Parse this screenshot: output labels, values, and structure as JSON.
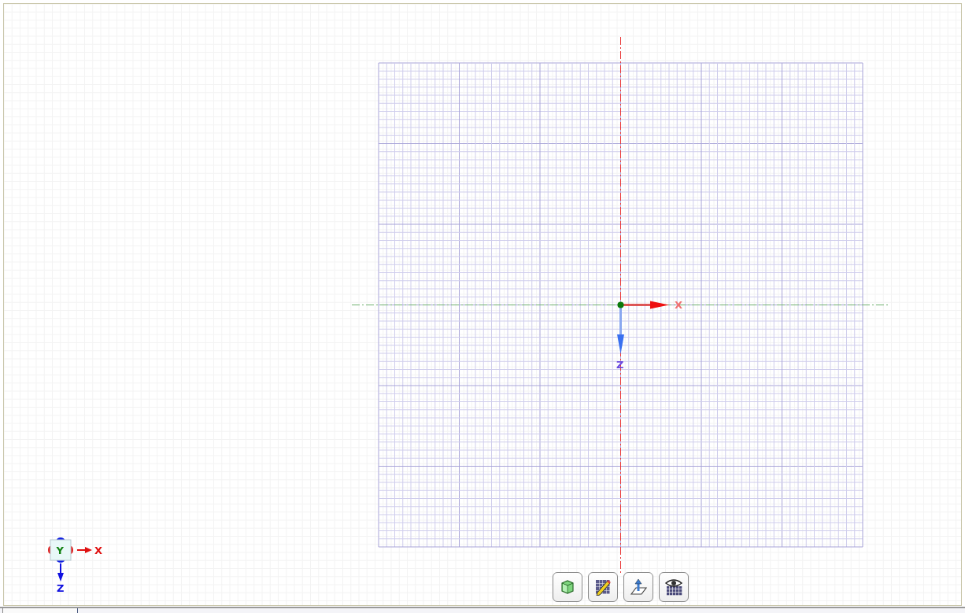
{
  "origin_axes": {
    "x_label": "X",
    "z_label": "Z"
  },
  "view_triad": {
    "center_label": "Y",
    "x_label": "X",
    "z_label": "Z"
  },
  "toolbar": [
    {
      "kind": "cube"
    },
    {
      "kind": "sketch"
    },
    {
      "kind": "plane"
    },
    {
      "kind": "view"
    }
  ]
}
